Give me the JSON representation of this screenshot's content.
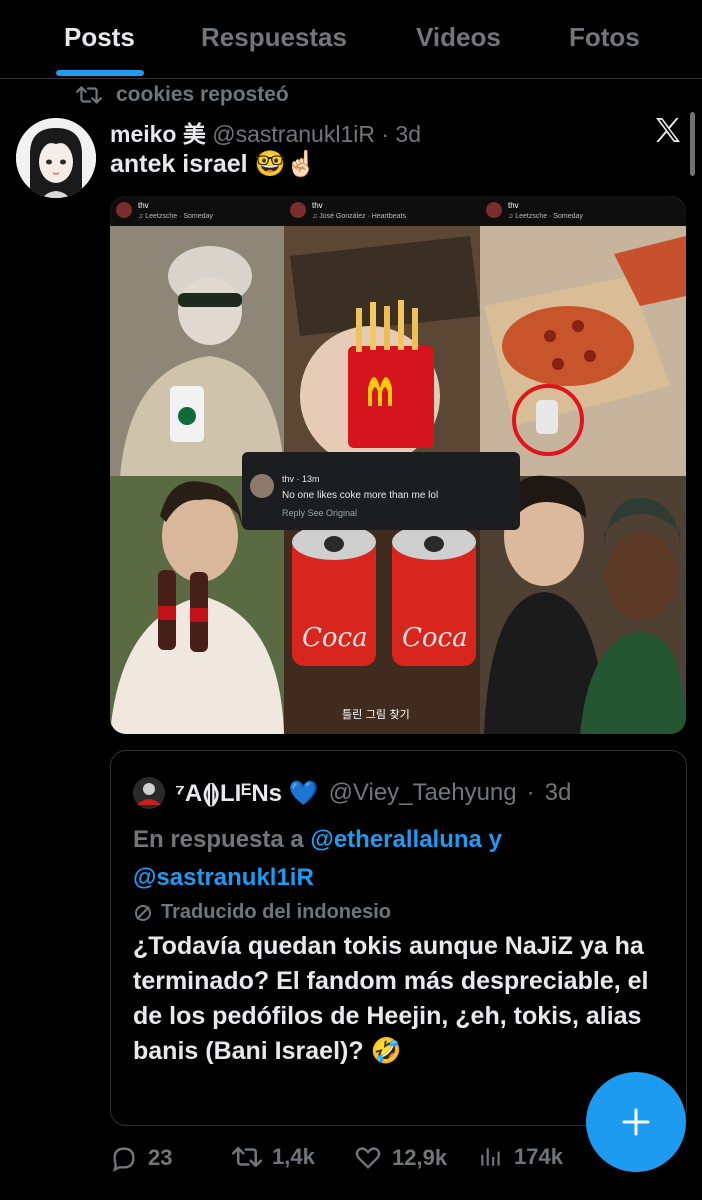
{
  "tabs": [
    {
      "label": "Posts",
      "active": true
    },
    {
      "label": "Respuestas"
    },
    {
      "label": "Videos"
    },
    {
      "label": "Fotos"
    }
  ],
  "repost": {
    "text": "cookies reposteó",
    "icon": "repost-icon"
  },
  "tweet": {
    "author_name": "meiko 美",
    "handle": "@sastranukl1iR",
    "dot": "·",
    "time": "3d",
    "text": "antek israel 🤓☝🏻"
  },
  "media_collage": {
    "top_labels": [
      {
        "user": "thv",
        "song": "♫ Leetzsche · Someday"
      },
      {
        "user": "thv",
        "song": "♫ José González · Heartbeats"
      },
      {
        "user": "thv",
        "song": "♫ Leetzsche · Someday"
      }
    ],
    "comment": {
      "user": "thv",
      "time": "13m",
      "text": "No one likes coke more than me lol",
      "reply": "Reply",
      "see_original": "See Original"
    },
    "bottom_caption": "틀린 그림 찾기",
    "can_text": "Coca"
  },
  "quote": {
    "author_name": "⁷A⟬⟭LIᴱNs 💙",
    "handle": "@Viey_Taehyung",
    "dot": "·",
    "time": "3d",
    "reply_prefix": "En respuesta a",
    "mention1": "@etherallaluna",
    "reply_conj": "y",
    "mention2": "@sastranukl1iR",
    "translated": "Traducido del indonesio",
    "body": "¿Todavía quedan tokis aunque NaJiZ ya ha terminado? El fandom más despreciable, el de los pedófilos de Heejin, ¿eh, tokis, alias banis (Bani Israel)? 🤣"
  },
  "actions": {
    "replies": "23",
    "reposts": "1,4k",
    "likes": "12,9k",
    "views": "174k"
  },
  "colors": {
    "accent": "#1d9bf0",
    "muted": "#71767b",
    "text": "#e7e9ea",
    "bg": "#000000"
  }
}
